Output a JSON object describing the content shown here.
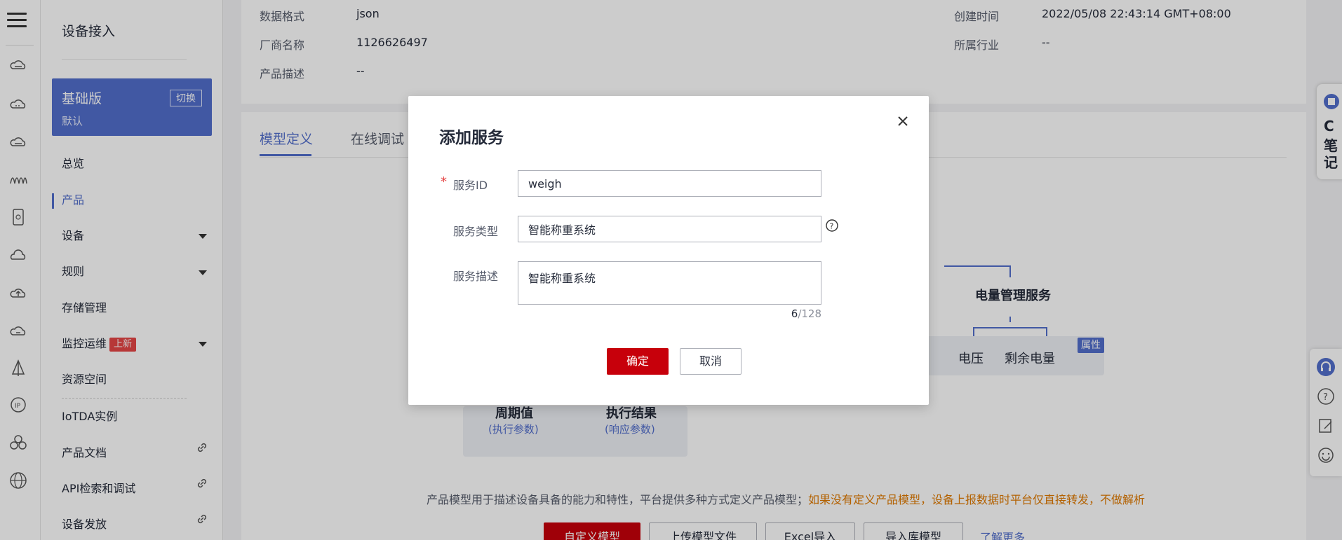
{
  "sidebar": {
    "title": "设备接入",
    "edition": {
      "name": "基础版",
      "sub": "默认",
      "switch_label": "切换"
    },
    "items": [
      {
        "label": "总览"
      },
      {
        "label": "产品"
      },
      {
        "label": "设备"
      },
      {
        "label": "规则"
      },
      {
        "label": "存储管理"
      },
      {
        "label": "监控运维",
        "badge": "上新"
      },
      {
        "label": "资源空间"
      },
      {
        "label": "IoTDA实例"
      },
      {
        "label": "产品文档"
      },
      {
        "label": "API检索和调试"
      },
      {
        "label": "设备发放"
      }
    ]
  },
  "product_info": {
    "data_format_label": "数据格式",
    "data_format": "json",
    "vendor_label": "厂商名称",
    "vendor": "1126626497",
    "desc_label": "产品描述",
    "desc": "--",
    "created_label": "创建时间",
    "created": "2022/05/08 22:43:14 GMT+08:00",
    "industry_label": "所属行业",
    "industry": "--"
  },
  "tabs": [
    {
      "label": "模型定义"
    },
    {
      "label": "在线调试"
    }
  ],
  "diagram": {
    "power_service": "电量管理服务",
    "voltage": "电压",
    "remaining": "剩余电量",
    "attr_badge": "属性",
    "period": "周期值",
    "period_sub": "(执行参数)",
    "result": "执行结果",
    "result_sub": "(响应参数)"
  },
  "model_desc": {
    "text": "产品模型用于描述设备具备的能力和特性，平台提供多种方式定义产品模型；",
    "warning": "如果没有定义产品模型，设备上报数据时平台仅直接转发，不做解析"
  },
  "model_buttons": {
    "custom": "自定义模型",
    "upload": "上传模型文件",
    "excel": "Excel导入",
    "import_lib": "导入库模型",
    "learn_more": "了解更多"
  },
  "float_note": {
    "chars": [
      "C",
      "笔",
      "记"
    ]
  },
  "dialog": {
    "title": "添加服务",
    "service_id_label": "服务ID",
    "service_id_value": "weigh",
    "service_type_label": "服务类型",
    "service_type_value": "智能称重系统",
    "service_desc_label": "服务描述",
    "service_desc_value": "智能称重系统",
    "counter_current": "6",
    "counter_max": "/128",
    "confirm": "确定",
    "cancel": "取消"
  },
  "colors": {
    "accent": "#526ecc",
    "primary_red": "#c7000b",
    "warning": "#e07a00"
  }
}
